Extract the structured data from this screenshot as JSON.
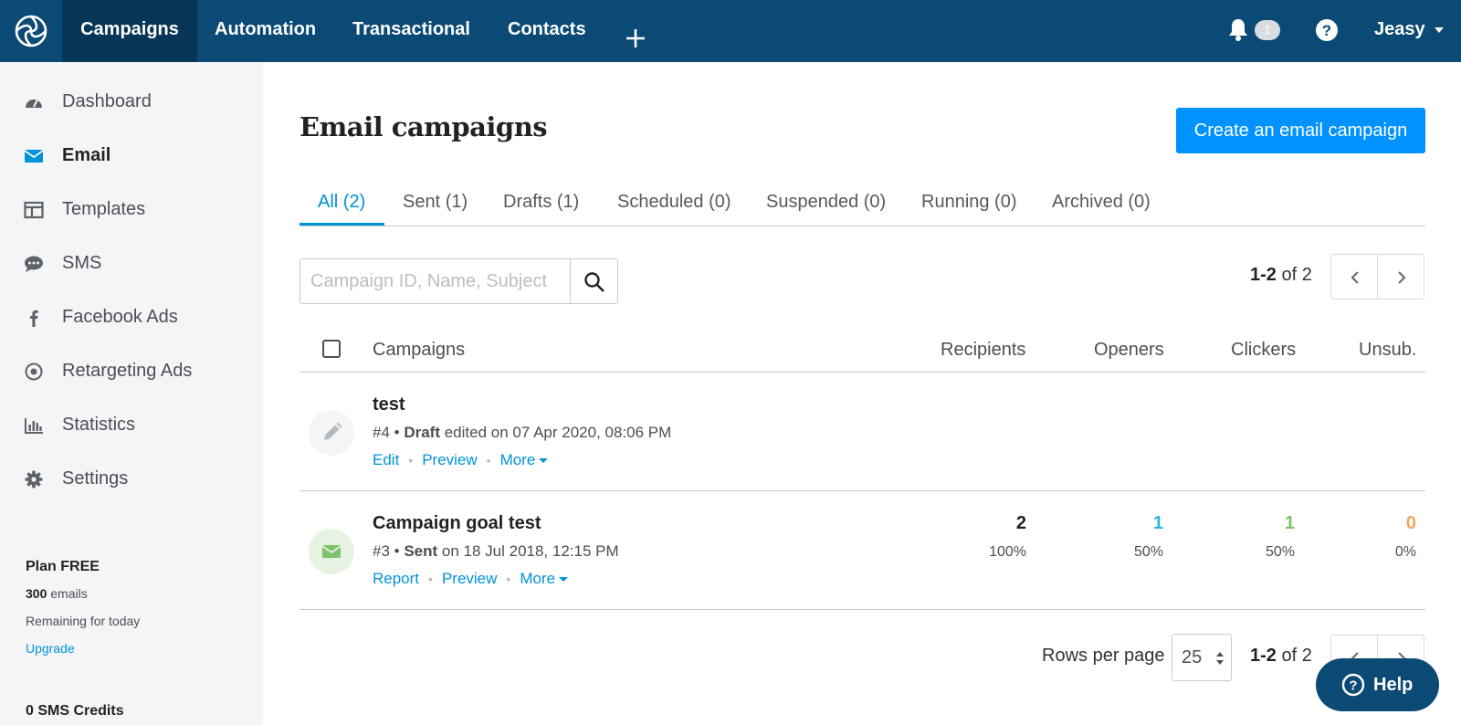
{
  "topnav": {
    "items": [
      {
        "label": "Campaigns",
        "active": true
      },
      {
        "label": "Automation"
      },
      {
        "label": "Transactional"
      },
      {
        "label": "Contacts"
      }
    ],
    "notification_count": "1",
    "user_name": "Jeasy"
  },
  "sidebar": {
    "items": [
      {
        "label": "Dashboard",
        "icon": "dashboard-icon"
      },
      {
        "label": "Email",
        "icon": "mail-icon",
        "active": true
      },
      {
        "label": "Templates",
        "icon": "templates-icon"
      },
      {
        "label": "SMS",
        "icon": "sms-icon"
      },
      {
        "label": "Facebook Ads",
        "icon": "facebook-icon"
      },
      {
        "label": "Retargeting Ads",
        "icon": "target-icon"
      },
      {
        "label": "Statistics",
        "icon": "bar-chart-icon"
      },
      {
        "label": "Settings",
        "icon": "gear-icon"
      }
    ],
    "plan": {
      "title": "Plan FREE",
      "emails_count": "300",
      "emails_label": " emails",
      "remaining": "Remaining for today",
      "upgrade": "Upgrade"
    },
    "sms_credits": "0 SMS Credits"
  },
  "main": {
    "title": "Email campaigns",
    "create_button": "Create an email campaign",
    "tabs": [
      {
        "label": "All (2)",
        "active": true
      },
      {
        "label": "Sent (1)"
      },
      {
        "label": "Drafts (1)"
      },
      {
        "label": "Scheduled (0)"
      },
      {
        "label": "Suspended (0)"
      },
      {
        "label": "Running (0)"
      },
      {
        "label": "Archived (0)"
      }
    ],
    "search": {
      "placeholder": "Campaign ID, Name, Subject"
    },
    "pagination": {
      "range": "1-2",
      "of_text": " of 2"
    },
    "columns": {
      "campaigns": "Campaigns",
      "recipients": "Recipients",
      "openers": "Openers",
      "clickers": "Clickers",
      "unsub": "Unsub."
    },
    "rows": [
      {
        "name": "test",
        "id": "#4",
        "status": "Draft",
        "detail": " edited on 07 Apr 2020, 08:06 PM",
        "actions": [
          "Edit",
          "Preview",
          "More"
        ]
      },
      {
        "name": "Campaign goal test",
        "id": "#3",
        "status": "Sent",
        "detail": " on 18 Jul 2018, 12:15 PM",
        "actions": [
          "Report",
          "Preview",
          "More"
        ],
        "recipients": "2",
        "recipients_pct": "100%",
        "openers": "1",
        "openers_pct": "50%",
        "clickers": "1",
        "clickers_pct": "50%",
        "unsub": "0",
        "unsub_pct": "0%"
      }
    ],
    "rows_per_page_label": "Rows per page",
    "rows_per_page_value": "25"
  },
  "help_button": "Help",
  "colors": {
    "nav_bg": "#0b4a75",
    "accent": "#0092ff",
    "openers": "#2bb5d8",
    "clickers": "#7dc36b",
    "unsub": "#f2a65a"
  }
}
